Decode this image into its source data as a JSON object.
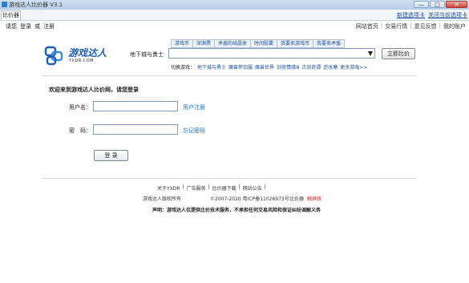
{
  "window": {
    "title": "游戏达人比价器 V3.1",
    "btn_min": "—",
    "btn_max": "□",
    "btn_close": "✕"
  },
  "tabs": {
    "active": "比价器",
    "new_tab": "新建选项卡",
    "close_tab": "关闭当前选项卡"
  },
  "topnav": {
    "login_prompt": "请您",
    "login": "登录",
    "or": "或",
    "register": "注册"
  },
  "rightnav": {
    "items": [
      "网站首页",
      "交易行情",
      "意见反馈",
      "我的账户"
    ],
    "sep": "|"
  },
  "logo": {
    "name": "游戏达人",
    "sub": "YXDR.COM"
  },
  "categories": [
    "游戏币",
    "深渊票",
    "矛盾的结晶体",
    "时间胶囊",
    "我要卖游戏币",
    "我要卖矛盾"
  ],
  "search": {
    "game_label": "地下城与勇士",
    "select_value": "",
    "compare_button": "立即比价"
  },
  "switch": {
    "label": "切换游戏：",
    "games": [
      "地下城与勇士",
      "魔兽怀旧服",
      "魔兽世界",
      "剑侠情缘Ⅲ",
      "古剑奇谭",
      "逆水寒",
      "更多游戏>>"
    ]
  },
  "login": {
    "welcome": "欢迎来到游戏达人比价网，请您登录",
    "username_label": "用户名：",
    "username_value": "",
    "register_link": "用户注册",
    "password_label": "密　码：",
    "password_value": "",
    "forgot_link": "忘记密码",
    "submit": "登 录"
  },
  "footer": {
    "links": [
      "关于YXDR",
      "|",
      "广告服务",
      "|",
      "比价器下载",
      "|",
      "网站公告",
      "|"
    ],
    "copyright_owner": "游戏达人版权所有",
    "copyright_years": "©2007-2020 粤ICP备11026973号",
    "copyright_tail": "比价器",
    "copyright_red": "触屏版",
    "disclaimer": "声明：游戏达人仅提供比价技术服务，不承担任何交易风险和保证纠纷调解义务"
  },
  "colors": {
    "link": "#1a4fa0",
    "accent": "#1e5fb4",
    "red": "#d22"
  }
}
